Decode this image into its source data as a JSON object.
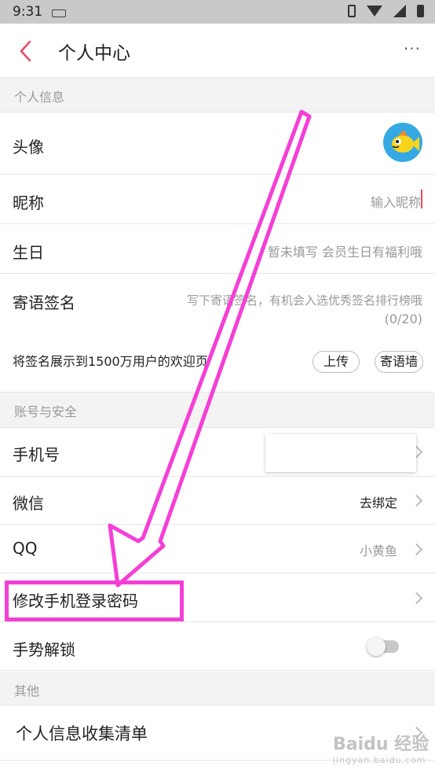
{
  "status_bar": {
    "time": "9:31"
  },
  "app_bar": {
    "title": "个人中心",
    "more": "···"
  },
  "sections": {
    "personal": "个人信息",
    "account": "账号与安全",
    "other": "其他"
  },
  "personal": {
    "avatar_label": "头像",
    "nickname_label": "昵称",
    "nickname_placeholder": "输入昵称",
    "birthday_label": "生日",
    "birthday_value": "暂未填写 会员生日有福利哦",
    "signature_label": "寄语签名",
    "signature_placeholder": "写下寄语签名，有机会入选优秀签名排行榜哦",
    "signature_counter": "(0/20)",
    "share_text": "将签名展示到1500万用户的欢迎页",
    "upload_button": "上传",
    "wall_button": "寄语墙"
  },
  "account": {
    "phone_label": "手机号",
    "wechat_label": "微信",
    "wechat_value": "去绑定",
    "qq_label": "QQ",
    "qq_value": "小黄鱼",
    "change_password_label": "修改手机登录密码",
    "gesture_lock_label": "手势解锁",
    "gesture_lock_enabled": false
  },
  "other": {
    "collection_list_label": "个人信息收集清单"
  },
  "watermark": {
    "brand": "Baidu 经验",
    "url": "jingyan.baidu.com"
  },
  "colors": {
    "accent": "#e84b63",
    "annotation": "#f43fd6"
  }
}
